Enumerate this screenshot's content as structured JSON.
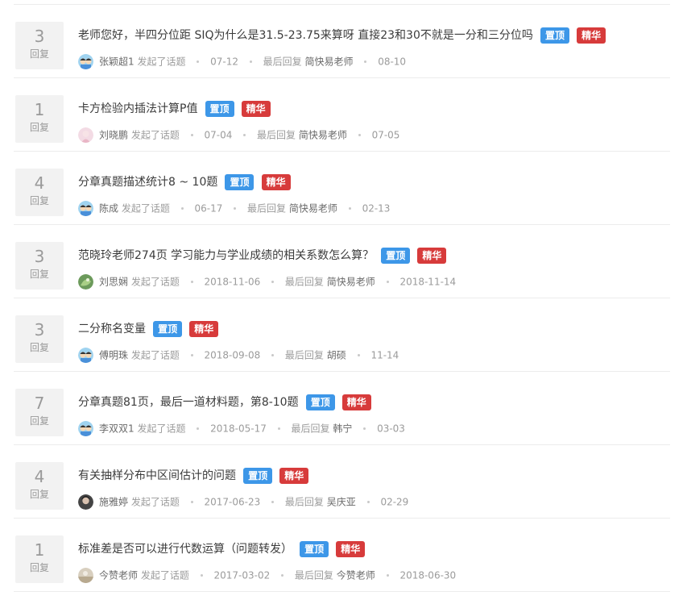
{
  "labels": {
    "reply": "回复",
    "started": "发起了话题",
    "last_reply": "最后回复",
    "sticky": "置顶",
    "essence": "精华"
  },
  "colors": {
    "sticky": "#3d97e8",
    "essence": "#d73b3b",
    "count_bg": "#f2f2f2"
  },
  "topics": [
    {
      "count": "3",
      "title": "老师您好，半四分位距 SIQ为什么是31.5-23.75来算呀 直接23和30不就是一分和三分位吗",
      "author": "张颖超1",
      "avatar": "cartoon-avatar",
      "date": "07-12",
      "last_replier": "简快易老师",
      "last_date": "08-10"
    },
    {
      "count": "1",
      "title": "卡方检验内插法计算P值",
      "author": "刘晓鹏",
      "avatar": "pink-avatar",
      "date": "07-04",
      "last_replier": "简快易老师",
      "last_date": "07-05"
    },
    {
      "count": "4",
      "title": "分章真题描述统计8 ~ 10题",
      "author": "陈成",
      "avatar": "cartoon-avatar",
      "date": "06-17",
      "last_replier": "简快易老师",
      "last_date": "02-13"
    },
    {
      "count": "3",
      "title": "范晓玲老师274页 学习能力与学业成绩的相关系数怎么算？",
      "author": "刘思娴",
      "avatar": "green-avatar",
      "date": "2018-11-06",
      "last_replier": "简快易老师",
      "last_date": "2018-11-14"
    },
    {
      "count": "3",
      "title": "二分称名变量",
      "author": "傅明珠",
      "avatar": "cartoon-avatar",
      "date": "2018-09-08",
      "last_replier": "胡硕",
      "last_date": "11-14"
    },
    {
      "count": "7",
      "title": "分章真题81页，最后一道材料题，第8-10题",
      "author": "李双双1",
      "avatar": "cartoon-avatar",
      "date": "2018-05-17",
      "last_replier": "韩宁",
      "last_date": "03-03"
    },
    {
      "count": "4",
      "title": "有关抽样分布中区间估计的问题",
      "author": "施雅婷",
      "avatar": "dark-avatar",
      "date": "2017-06-23",
      "last_replier": "吴庆亚",
      "last_date": "02-29"
    },
    {
      "count": "1",
      "title": "标准差是否可以进行代数运算（问题转发）",
      "author": "今赞老师",
      "avatar": "beige-avatar",
      "date": "2017-03-02",
      "last_replier": "今赞老师",
      "last_date": "2018-06-30"
    }
  ]
}
